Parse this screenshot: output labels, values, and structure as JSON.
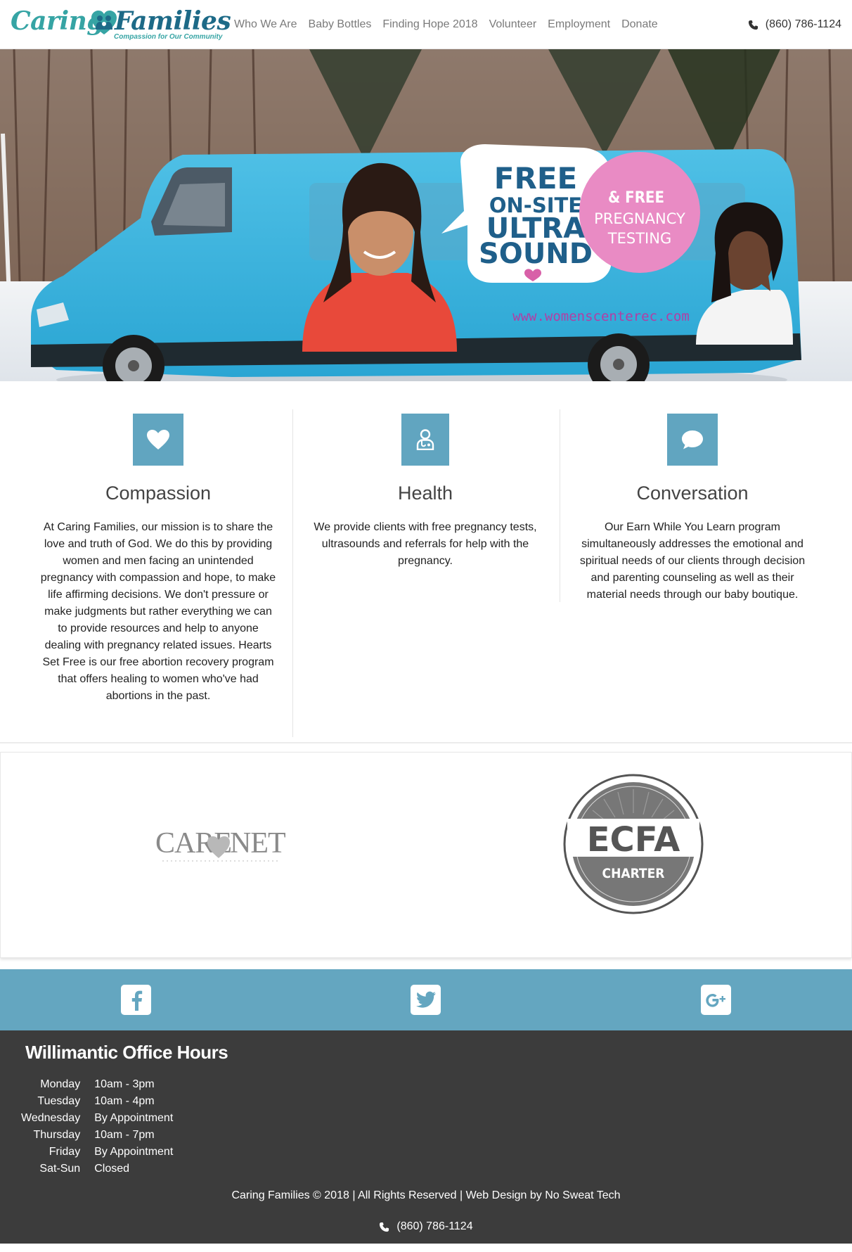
{
  "brand": {
    "name_part1": "Caring",
    "name_part2": "Families",
    "tagline": "Compassion for Our Community",
    "primary_color": "#36a4a4",
    "secondary_color": "#1d6a87"
  },
  "nav": {
    "items": [
      {
        "label": "Who We Are"
      },
      {
        "label": "Baby Bottles"
      },
      {
        "label": "Finding Hope 2018"
      },
      {
        "label": "Volunteer"
      },
      {
        "label": "Employment"
      },
      {
        "label": "Donate"
      }
    ],
    "phone": "(860) 786-1124",
    "phone_icon": "phone-icon"
  },
  "hero": {
    "van_bubble_line1": "FREE",
    "van_bubble_line2": "ON-SITE",
    "van_bubble_line3": "ULTRA",
    "van_bubble_line4": "SOUND",
    "van_badge_line1": "& FREE",
    "van_badge_line2": "PREGNANCY",
    "van_badge_line3": "TESTING",
    "van_url": "www.womenscenterec.com"
  },
  "features": [
    {
      "icon": "heart-icon",
      "title": "Compassion",
      "text": "At Caring Families, our mission is to share the love and truth of God. We do this by providing women and men facing an unintended pregnancy with compassion and hope, to make life affirming decisions. We don't pressure or make judgments but rather everything we can to provide resources and help to anyone dealing with pregnancy related issues. Hearts Set Free is our free abortion recovery program that offers healing to women who've had abortions in the past."
    },
    {
      "icon": "doctor-icon",
      "title": "Health",
      "text": "We provide clients with free pregnancy tests, ultrasounds and referrals for help with the pregnancy."
    },
    {
      "icon": "speech-bubble-icon",
      "title": "Conversation",
      "text": "Our Earn While You Learn program simultaneously addresses the emotional and spiritual needs of our clients through decision and parenting counseling as well as their material needs through our baby boutique."
    }
  ],
  "partners": {
    "carenet_part1": "CARE",
    "carenet_part2": "NET",
    "ecfa_name": "ECFA",
    "ecfa_sub": "CHARTER"
  },
  "social": {
    "accent_color": "#64a6c0",
    "icons": [
      "facebook-icon",
      "twitter-icon",
      "google-plus-icon"
    ]
  },
  "footer": {
    "hours_title": "Willimantic Office Hours",
    "hours": [
      {
        "day": "Monday",
        "time": "10am - 3pm"
      },
      {
        "day": "Tuesday",
        "time": "10am - 4pm"
      },
      {
        "day": "Wednesday",
        "time": "By Appointment"
      },
      {
        "day": "Thursday",
        "time": "10am - 7pm"
      },
      {
        "day": "Friday",
        "time": "By Appointment"
      },
      {
        "day": "Sat-Sun",
        "time": "Closed"
      }
    ],
    "copyright": "Caring Families © 2018 | All Rights Reserved | ",
    "credit_link": "Web Design by No Sweat Tech",
    "phone": "(860) 786-1124",
    "background": "#3c3c3c"
  }
}
